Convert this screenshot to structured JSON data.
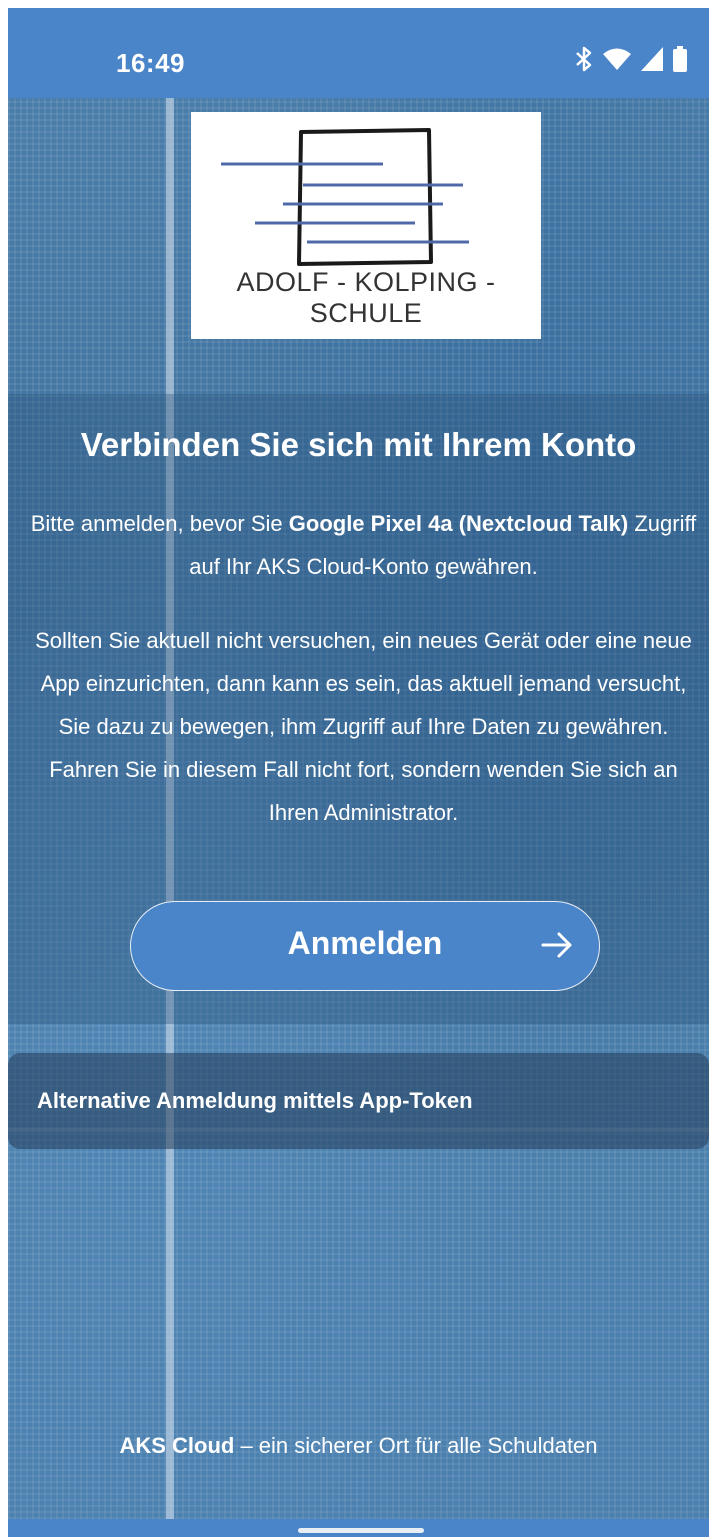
{
  "status_bar": {
    "time": "16:49",
    "icons": [
      "bluetooth-icon",
      "wifi-icon",
      "signal-icon",
      "battery-icon"
    ]
  },
  "logo": {
    "text": "ADOLF - KOLPING - SCHULE"
  },
  "main": {
    "title": "Verbinden Sie sich mit Ihrem Konto",
    "intro_prefix": "Bitte anmelden, bevor Sie ",
    "intro_app": "Google Pixel 4a (Nextcloud Talk)",
    "intro_suffix": " Zugriff auf Ihr AKS Cloud-Konto gewähren.",
    "warning": "Sollten Sie aktuell nicht versuchen, ein neues Gerät oder eine neue App einzurichten, dann kann es sein, das aktuell jemand versucht, Sie dazu zu bewegen, ihm Zugriff auf Ihre Daten zu gewähren. Fahren Sie in diesem Fall nicht fort, sondern wenden Sie sich an Ihren Administrator.",
    "login_button": "Anmelden"
  },
  "alternative": {
    "label": "Alternative Anmeldung mittels App-Token"
  },
  "footer": {
    "brand": "AKS Cloud",
    "tagline": " – ein sicherer Ort für alle Schuldaten"
  },
  "colors": {
    "accent": "#4a84c9",
    "background": "#4a7fae"
  }
}
